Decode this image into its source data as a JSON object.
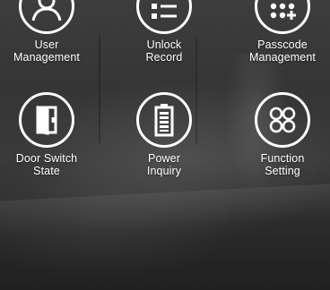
{
  "menu": {
    "items": [
      {
        "id": "user-management",
        "label_line1": "User",
        "label_line2": "Management",
        "icon": "user-icon"
      },
      {
        "id": "unlock-record",
        "label_line1": "Unlock",
        "label_line2": "Record",
        "icon": "list-icon"
      },
      {
        "id": "passcode-management",
        "label_line1": "Passcode",
        "label_line2": "Management",
        "icon": "keypad-icon"
      },
      {
        "id": "door-switch-state",
        "label_line1": "Door Switch",
        "label_line2": "State",
        "icon": "door-icon"
      },
      {
        "id": "power-inquiry",
        "label_line1": "Power",
        "label_line2": "Inquiry",
        "icon": "battery-icon"
      },
      {
        "id": "function-setting",
        "label_line1": "Function",
        "label_line2": "Setting",
        "icon": "grid-circles-icon"
      }
    ]
  },
  "colors": {
    "icon_stroke": "#ffffff",
    "label_text": "#ffffff",
    "background_dark": "#2a2a2a"
  }
}
